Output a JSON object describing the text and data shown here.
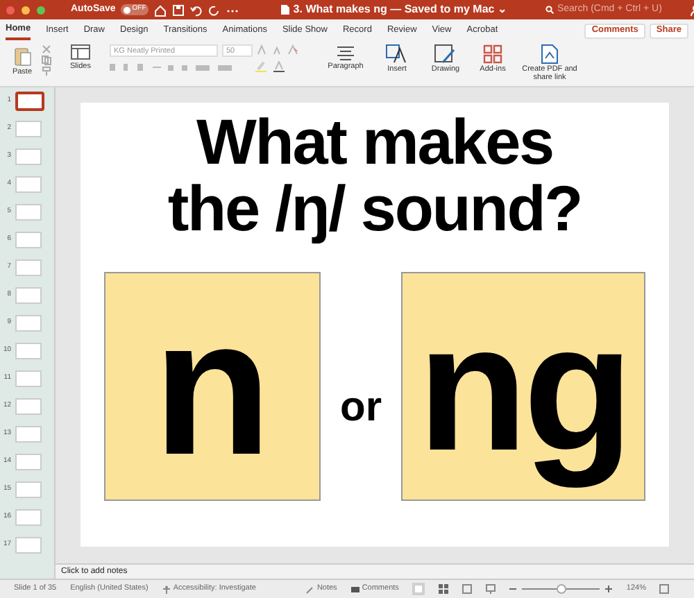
{
  "title_bar": {
    "autosave": "AutoSave",
    "autosave_state": "OFF",
    "title": "3. What makes ng — Saved to my Mac ⌄",
    "search": {
      "placeholder": "Search (Cmd + Ctrl + U)"
    }
  },
  "tabs": [
    {
      "label": "Home",
      "selected": true
    },
    {
      "label": "Insert",
      "selected": false
    },
    {
      "label": "Draw",
      "selected": false
    },
    {
      "label": "Design",
      "selected": false
    },
    {
      "label": "Transitions",
      "selected": false
    },
    {
      "label": "Animations",
      "selected": false
    },
    {
      "label": "Slide Show",
      "selected": false
    },
    {
      "label": "Record",
      "selected": false
    },
    {
      "label": "Review",
      "selected": false
    },
    {
      "label": "View",
      "selected": false
    },
    {
      "label": "Acrobat",
      "selected": false
    }
  ],
  "tab_buttons": [
    "Comments",
    "Share"
  ],
  "ribbon": {
    "paste": "Paste",
    "slides": "Slides",
    "font_name": "KG Neatly Printed",
    "font_size": "50",
    "paragraph": "Paragraph",
    "insert": "Insert",
    "drawing": "Drawing",
    "add_ins": "Add-ins",
    "create_pdf": "Create PDF and share link"
  },
  "thumbnails": [
    {
      "number": "1",
      "selected": true
    },
    {
      "number": "2",
      "selected": false
    },
    {
      "number": "3",
      "selected": false
    },
    {
      "number": "4",
      "selected": false
    },
    {
      "number": "5",
      "selected": false
    },
    {
      "number": "6",
      "selected": false
    },
    {
      "number": "7",
      "selected": false
    },
    {
      "number": "8",
      "selected": false
    },
    {
      "number": "9",
      "selected": false
    },
    {
      "number": "10",
      "selected": false
    },
    {
      "number": "11",
      "selected": false
    },
    {
      "number": "12",
      "selected": false
    },
    {
      "number": "13",
      "selected": false
    },
    {
      "number": "14",
      "selected": false
    },
    {
      "number": "15",
      "selected": false
    },
    {
      "number": "16",
      "selected": false
    },
    {
      "number": "17",
      "selected": false
    }
  ],
  "slide": {
    "title_lines": [
      "What makes",
      "the /ŋ/ sound?"
    ],
    "left_card": "n",
    "connector": "or",
    "right_card": "ng"
  },
  "notes_placeholder": "Click to add notes",
  "status_bar": {
    "slide": "Slide 1 of 35",
    "language": "English (United States)",
    "accessibility": "Accessibility: Investigate",
    "notes": "Notes",
    "comments": "Comments",
    "zoom": {
      "level": 0.5
    },
    "zoom_text": "124%"
  }
}
